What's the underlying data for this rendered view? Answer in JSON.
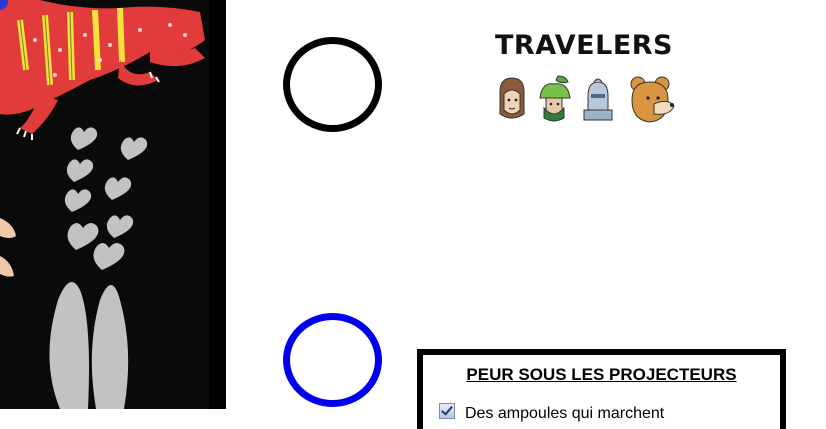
{
  "travelers": {
    "title": "TRAVELERS",
    "members": [
      {
        "icon": "human-head-icon"
      },
      {
        "icon": "apple-helmet-icon"
      },
      {
        "icon": "knight-helmet-icon"
      },
      {
        "icon": "bear-head-icon"
      }
    ]
  },
  "slots": [
    {
      "name": "slot-ring-1",
      "color": "#000000"
    },
    {
      "name": "slot-ring-2",
      "color": "#0000ee"
    }
  ],
  "card": {
    "title": "PEUR SOUS LES PROJECTEURS",
    "items": [
      {
        "label": "Des ampoules qui marchent"
      }
    ]
  },
  "art": {
    "subject": "illustration-panel",
    "colors": {
      "background": "#0a0a0a",
      "dragon": "#e23b3b",
      "stripes": "#f2e23a",
      "smoke": "#bdbdbd"
    }
  }
}
